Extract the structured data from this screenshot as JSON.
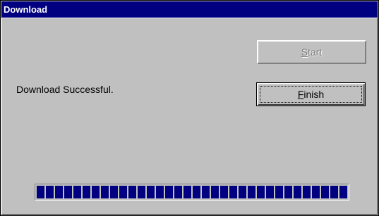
{
  "window": {
    "title": "Download"
  },
  "message": "Download Successful.",
  "buttons": {
    "start_label": "Start",
    "start_mnemonic": "S",
    "start_rest": "tart",
    "start_enabled": false,
    "finish_label": "Finish",
    "finish_mnemonic": "F",
    "finish_rest": "inish"
  },
  "progress": {
    "value": 1.0
  },
  "colors": {
    "title_bar": "#000080",
    "face": "#c0c0c0",
    "progress_fill": "#000080",
    "disabled_text": "#808080"
  }
}
